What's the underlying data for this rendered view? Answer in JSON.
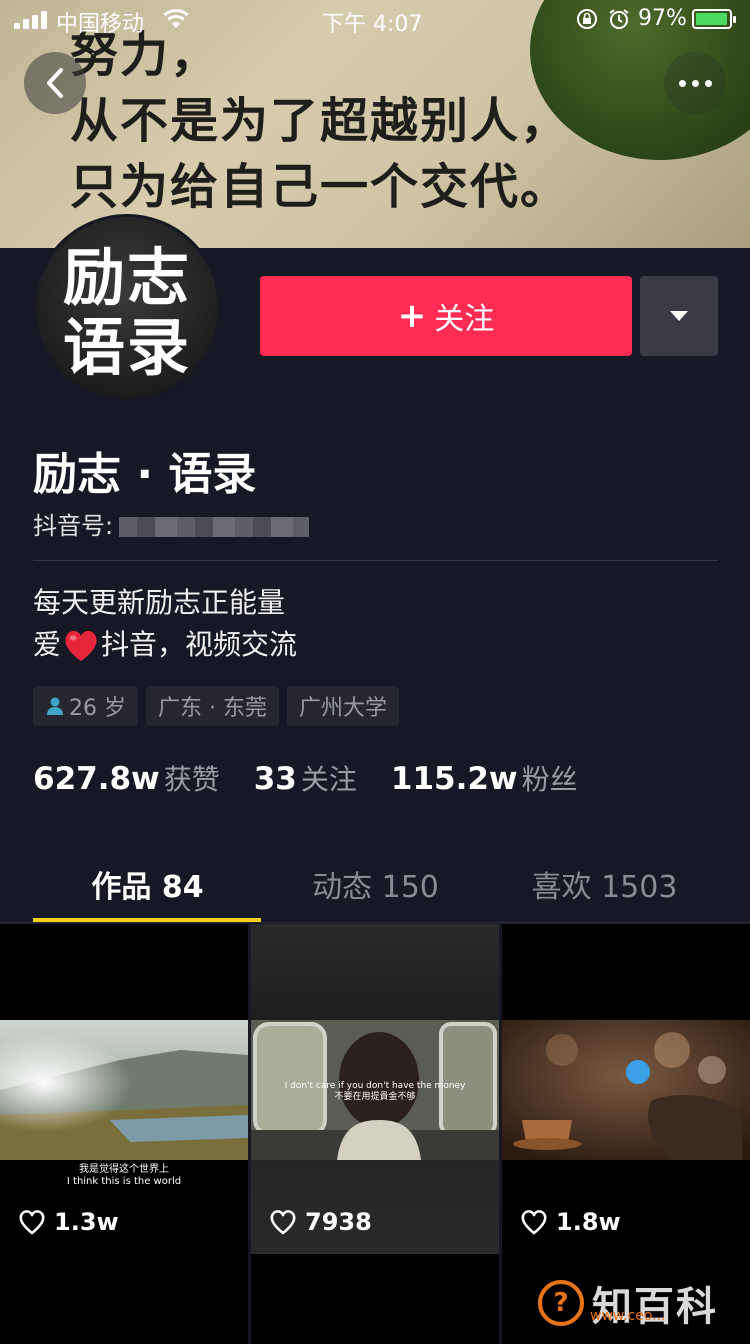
{
  "status_bar": {
    "carrier": "中国移动",
    "time": "下午 4:07",
    "battery_percent": "97%",
    "battery_level": 0.97
  },
  "banner": {
    "lines": [
      "努力，",
      "从不是为了超越别人，",
      "只为给自己一个交代。"
    ]
  },
  "avatar": {
    "text_line1": "励志",
    "text_line2": "语录"
  },
  "actions": {
    "follow_plus": "+",
    "follow_label": "关注"
  },
  "profile": {
    "name": "励志 · 语录",
    "uid_label": "抖音号:",
    "bio_line1": "每天更新励志正能量",
    "bio_line2_before": "爱",
    "bio_line2_after": "抖音，视频交流"
  },
  "tags": [
    {
      "text": "26 岁",
      "icon": "person-icon"
    },
    {
      "text": "广东 · 东莞"
    },
    {
      "text": "广州大学"
    }
  ],
  "stats": [
    {
      "num": "627.8w",
      "label": "获赞"
    },
    {
      "num": "33",
      "label": "关注"
    },
    {
      "num": "115.2w",
      "label": "粉丝"
    }
  ],
  "tabs": [
    {
      "label": "作品 84",
      "active": true
    },
    {
      "label": "动态 150",
      "active": false
    },
    {
      "label": "喜欢 1503",
      "active": false
    }
  ],
  "videos": [
    {
      "likes": "1.3w",
      "subtitle_cn": "我是觉得这个世界上",
      "subtitle_en": "I think this is the world"
    },
    {
      "likes": "7938",
      "subtitle_en": "I don't care if you don't have the money",
      "subtitle_cn": "不要在用提貴金不够"
    },
    {
      "likes": "1.8w"
    }
  ],
  "watermark": {
    "symbol": "?",
    "text": "知百科",
    "url": "www.ceo..."
  },
  "colors": {
    "background": "#161823",
    "follow_button": "#fe2c55",
    "tab_underline": "#face15"
  }
}
